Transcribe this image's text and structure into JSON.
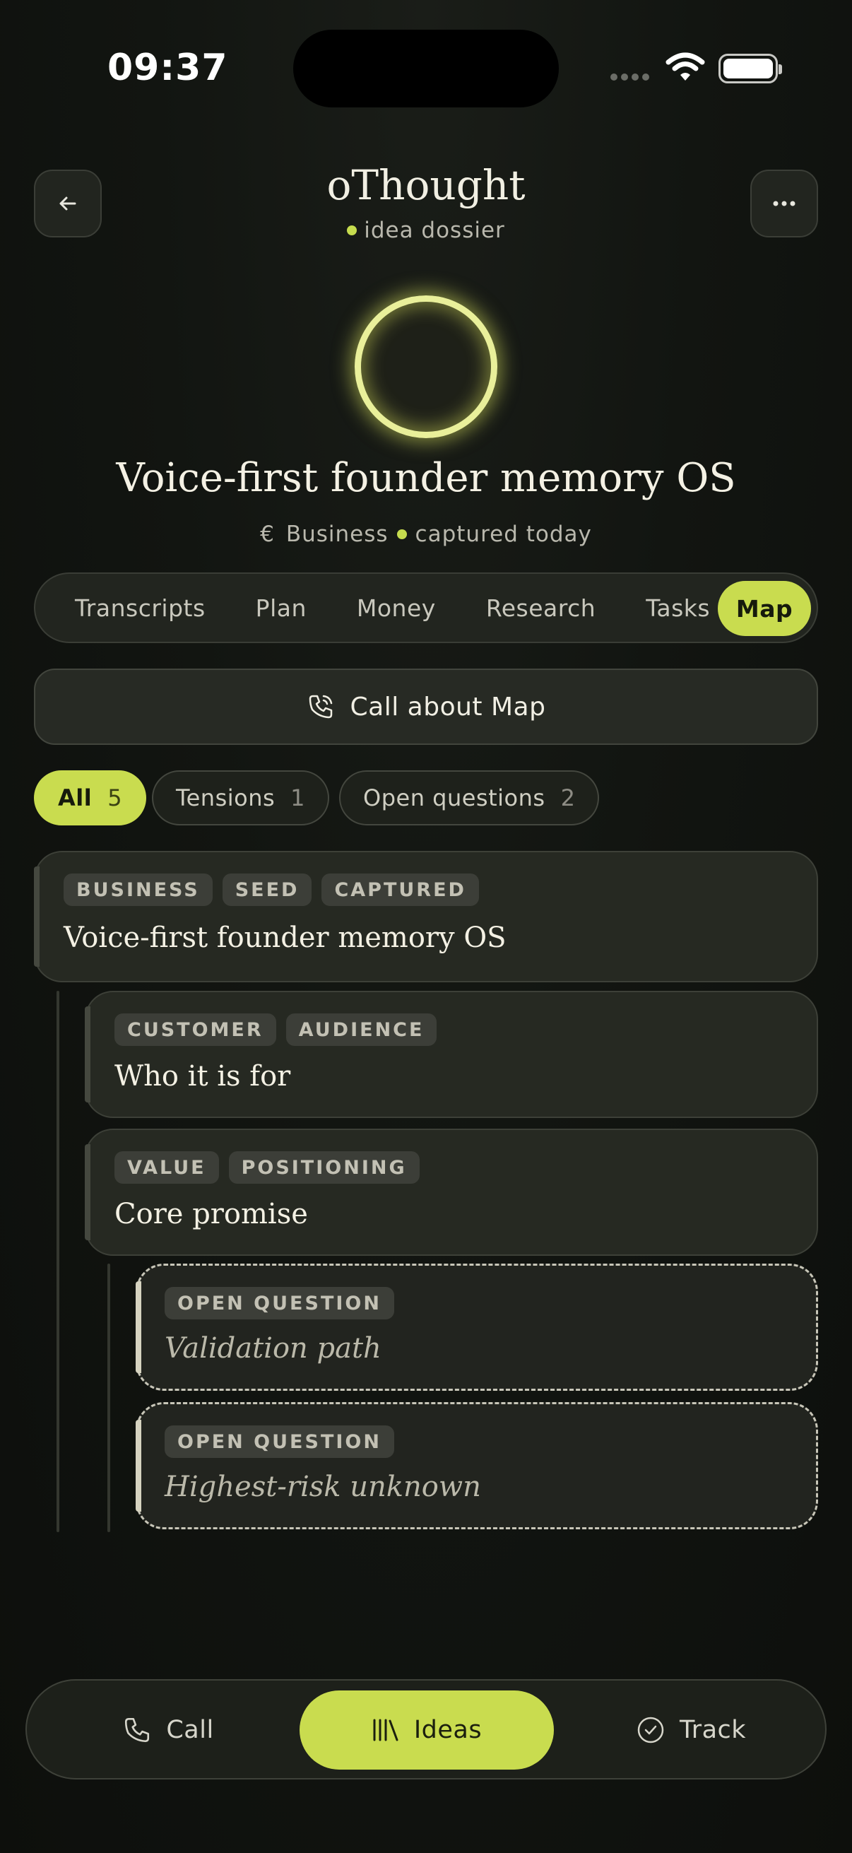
{
  "status_bar": {
    "time": "09:37"
  },
  "header": {
    "title": "oThought",
    "subtitle": "idea dossier"
  },
  "idea": {
    "title": "Voice-first founder memory OS",
    "currency_symbol": "€",
    "category": "Business",
    "captured": "captured today"
  },
  "tabs": [
    {
      "label": "Transcripts"
    },
    {
      "label": "Plan"
    },
    {
      "label": "Money"
    },
    {
      "label": "Research"
    },
    {
      "label": "Tasks"
    },
    {
      "label": "Map"
    }
  ],
  "call_button": {
    "label": "Call about Map"
  },
  "filters": [
    {
      "label": "All",
      "count": "5"
    },
    {
      "label": "Tensions",
      "count": "1"
    },
    {
      "label": "Open questions",
      "count": "2"
    }
  ],
  "map_nodes": [
    {
      "tags": [
        "BUSINESS",
        "SEED",
        "CAPTURED"
      ],
      "title": "Voice-first founder memory OS"
    },
    {
      "tags": [
        "CUSTOMER",
        "AUDIENCE"
      ],
      "title": "Who it is for"
    },
    {
      "tags": [
        "VALUE",
        "POSITIONING"
      ],
      "title": "Core promise"
    },
    {
      "tags": [
        "OPEN QUESTION"
      ],
      "title": "Validation path"
    },
    {
      "tags": [
        "OPEN QUESTION"
      ],
      "title": "Highest-risk unknown"
    }
  ],
  "bottom_nav": [
    {
      "label": "Call",
      "icon": "phone-icon"
    },
    {
      "label": "Ideas",
      "icon": "library-icon"
    },
    {
      "label": "Track",
      "icon": "check-circle-icon"
    }
  ],
  "colors": {
    "accent": "#c9dc4f",
    "background": "#121511",
    "card": "#262922"
  }
}
